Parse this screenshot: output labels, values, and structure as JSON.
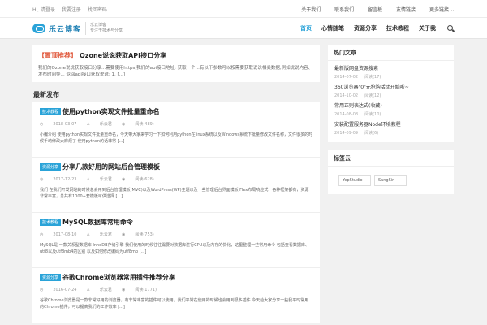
{
  "topbar": {
    "links": [
      "Hi, 请登录",
      "我要注册",
      "找回密码"
    ],
    "right": [
      "关于我们",
      "联系我们",
      "留言板",
      "友情链接",
      "更多链接"
    ]
  },
  "header": {
    "logo_text": "乐云博客",
    "logo_sub_line1": "乐云博客",
    "logo_sub_line2": "专注于技术与分享",
    "nav": [
      "首页",
      "心情随笔",
      "资源分享",
      "技术教程",
      "关于我"
    ]
  },
  "sticky": {
    "tag": "【置顶推荐】",
    "title": "Qzone说说获取API接口分享",
    "desc": "我们的Qzone说说获取接口分享...需要使用https,我们的api接口地址: 获取一个...有以下参数可以按需要获取说说相关数据,例如说说内容、发布时间等... 返回api接口获取说说: 1. [...]"
  },
  "section_title": "最新发布",
  "posts": [
    {
      "category": "技术教程",
      "title": "使用python实现文件批量重命名",
      "date": "2018-03-07",
      "author": "乐云君",
      "views": "阅读(489)",
      "desc": "小编介绍 使用python实现文件批量重命名，今天带大家来学习一下如何利用python在linux系统以及Windows系统下批量修改文件名称，文件很多的时候手动修改太麻烦了 使用python的话非常 [...]"
    },
    {
      "category": "资源分享",
      "title": "分享几款好用的网站后台管理模板",
      "date": "2017-12-23",
      "author": "乐云君",
      "views": "阅读(628)",
      "desc": "我们 在我们开发网站的时候总会用到后台管理模板(MVC)以及WordPress(WP)主题以及一些管理后台界面模板 Flex布局响应式，各种框架都有，资源非常丰富，总共有1000+套模板可供选择 [...]"
    },
    {
      "category": "技术教程",
      "title": "MySQL数据库常用命令",
      "date": "2017-08-10",
      "author": "乐云君",
      "views": "阅读(753)",
      "desc": "MySQL是 一款关系型数据库 InnoDB存储引擎 我们使用的时候往往需要对数据库进行CPU以及内存的优化，这里整理一些常用命令 包括查看数据库、utf8以及utf8mb4的区别 以及如何修改编码为utf8mb [...]"
    },
    {
      "category": "资源分享",
      "title": "谷歌Chrome浏览器常用插件推荐分享",
      "date": "2016-07-24",
      "author": "乐云君",
      "views": "阅读(1771)",
      "desc": "谷歌Chrome浏览器是一款非常好用的浏览器，有非常丰富的插件可以使用，我们平常在使用的时候也会用到很多插件 今天给大家分享一些我平时常用的Chrome插件，可以提高我们的工作效率 [...]"
    }
  ],
  "sidebar": {
    "hot_title": "热门文章",
    "hot": [
      {
        "title": "最新版网盘资源搜索",
        "date": "2014-07-02",
        "views": "阅读(17)"
      },
      {
        "title": "360浏览器\"0\"元抢购活动开始啦~",
        "date": "2014-10-02",
        "views": "阅读(12)"
      },
      {
        "title": "常用正则表达式(收藏)",
        "date": "2014-08-08",
        "views": "阅读(10)"
      },
      {
        "title": "安装配置服务器Node环境教程",
        "date": "2014-09-09",
        "views": "阅读(6)"
      }
    ],
    "tags_title": "标签云",
    "tags": [
      "YepStudio",
      "SangSir"
    ]
  }
}
